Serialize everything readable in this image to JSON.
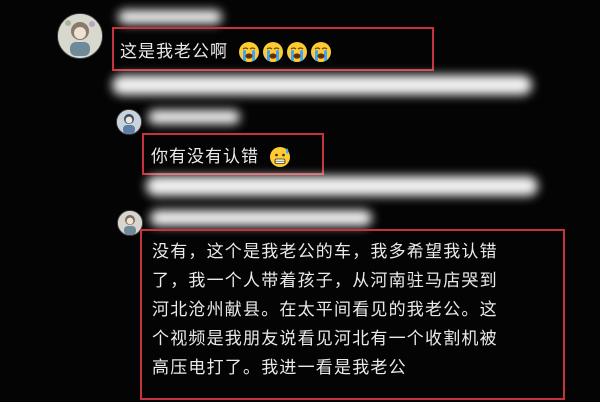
{
  "chat": {
    "messages": [
      {
        "text": "这是我老公啊",
        "emojis": [
          "loudly-crying-face-emoji",
          "loudly-crying-face-emoji",
          "loudly-crying-face-emoji",
          "loudly-crying-face-emoji"
        ]
      },
      {
        "text": "你有没有认错",
        "emojis": [
          "grimacing-sweat-face-emoji"
        ]
      },
      {
        "lines": [
          "没有，这个是我老公的车，我多希望我认错",
          "了，我一个人带着孩子，从河南驻马店哭到",
          "河北沧州献县。在太平间看见的我老公。这",
          "个视频是我朋友说看见河北有一个收割机被",
          "高压电打了。我进一看是我老公"
        ]
      }
    ]
  },
  "colors": {
    "background": "#040404",
    "highlight_box": "#c8323c",
    "redaction": "#ffffff",
    "text": "#eaeaea"
  }
}
